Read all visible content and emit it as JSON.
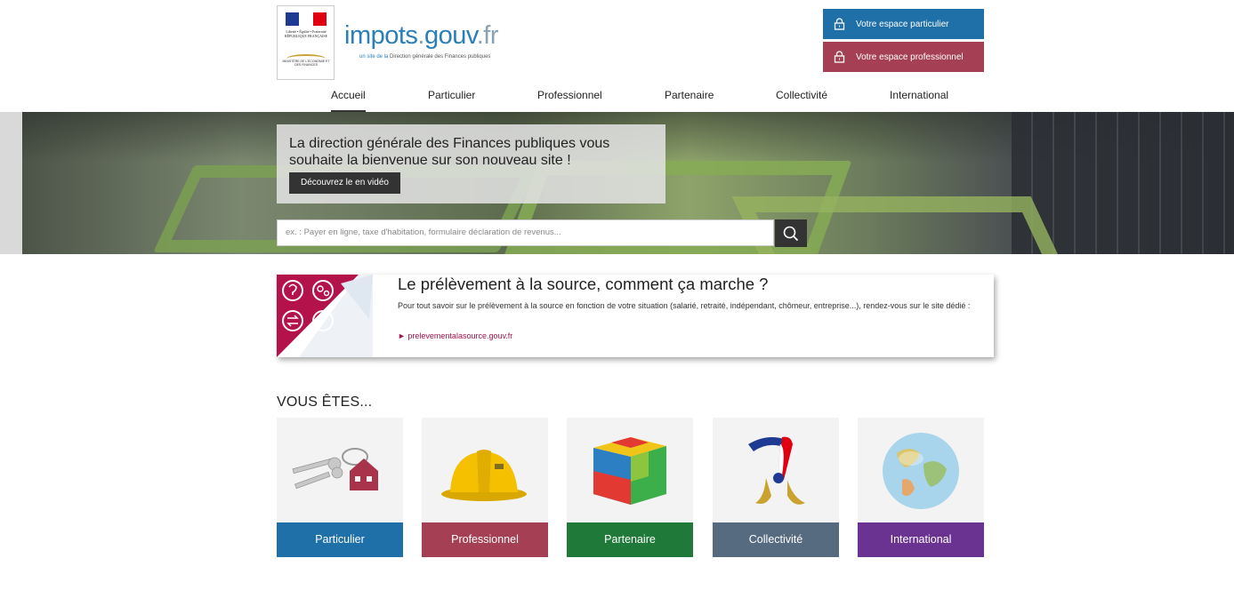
{
  "header": {
    "rf_logo_text": "Liberté • Égalité • Fraternité RÉPUBLIQUE FRANÇAISE",
    "ministry_text": "MINISTÈRE DE L'ÉCONOMIE ET DES FINANCES",
    "brand_main": "impots",
    "brand_dot": ".",
    "brand_gouv": "gouv",
    "brand_fr": ".fr",
    "tagline_prefix": "un site de la",
    "tagline_main": "Direction générale des Finances publiques",
    "btn_particulier": "Votre espace particulier",
    "btn_professionnel": "Votre espace professionnel"
  },
  "nav": {
    "items": [
      "Accueil",
      "Particulier",
      "Professionnel",
      "Partenaire",
      "Collectivité",
      "International"
    ]
  },
  "hero": {
    "welcome": "La direction générale des Finances publiques vous souhaite la bienvenue sur son nouveau site !",
    "video_button": "Découvrez le en vidéo",
    "search_placeholder": "ex. : Payer en ligne, taxe d'habitation, formulaire déclaration de revenus..."
  },
  "promo": {
    "title": "Le prélèvement à la source, comment ça marche ?",
    "description": "Pour tout savoir sur le prélèvement à la source en fonction de votre situation (salarié, retraité, indépendant, chômeur, entreprise...), rendez-vous sur le site dédié :",
    "link": "► prelevementalasource.gouv.fr"
  },
  "vous_etes": {
    "heading": "VOUS ÊTES...",
    "cards": [
      {
        "label": "Particulier",
        "color": "#1f6fa9",
        "icon": "keys-icon"
      },
      {
        "label": "Professionnel",
        "color": "#a53f54",
        "icon": "hard-hat-icon"
      },
      {
        "label": "Partenaire",
        "color": "#1f7a3a",
        "icon": "puzzle-cube-icon"
      },
      {
        "label": "Collectivité",
        "color": "#566a80",
        "icon": "mayor-sash-icon"
      },
      {
        "label": "International",
        "color": "#6a3291",
        "icon": "globe-icon"
      }
    ]
  }
}
